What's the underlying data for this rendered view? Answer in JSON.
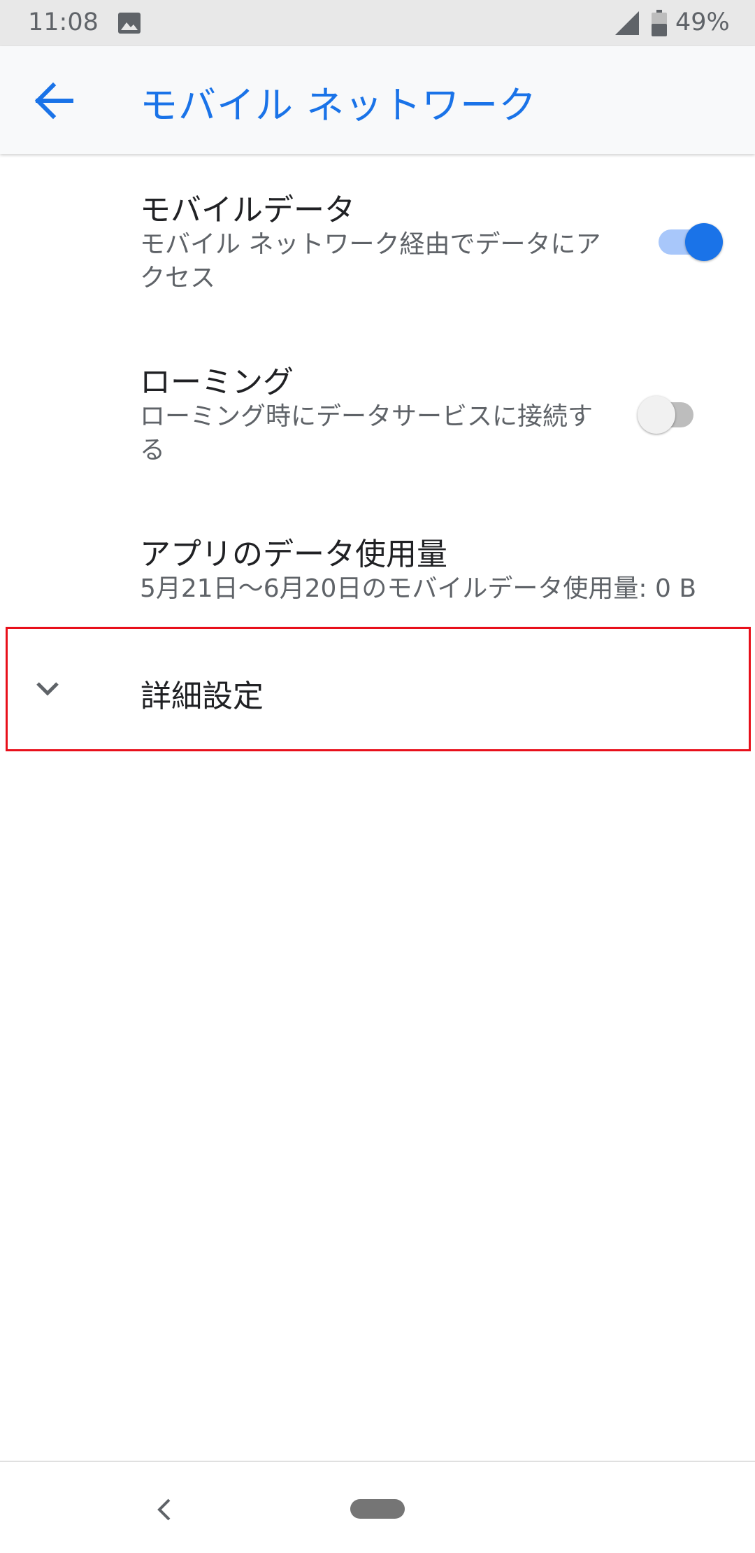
{
  "status_bar": {
    "time": "11:08",
    "battery_percent": "49%",
    "icons": [
      "image-icon",
      "signal-icon",
      "battery-icon"
    ]
  },
  "app_bar": {
    "title": "モバイル ネットワーク",
    "back_icon": "arrow-back-icon",
    "accent_color": "#1a73e8"
  },
  "preferences": [
    {
      "title": "モバイルデータ",
      "summary": "モバイル ネットワーク経由でデータにアクセス",
      "toggle_on": true
    },
    {
      "title": "ローミング",
      "summary": "ローミング時にデータサービスに接続する",
      "toggle_on": false
    },
    {
      "title": "アプリのデータ使用量",
      "summary": "5月21日〜6月20日のモバイルデータ使用量: 0 B"
    }
  ],
  "advanced": {
    "label": "詳細設定",
    "icon": "chevron-down-icon",
    "highlight_color": "#e8101b"
  },
  "nav_bar": {
    "back_icon": "nav-back-icon",
    "home_icon": "home-pill-icon"
  }
}
